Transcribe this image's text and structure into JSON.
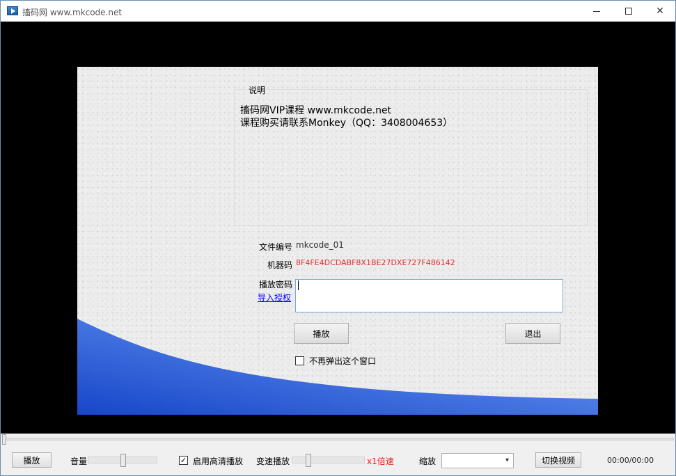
{
  "window": {
    "title": "搐码网 www.mkcode.net",
    "minimize_glyph": "",
    "close_glyph": "✕"
  },
  "dialog": {
    "group_title": "说明",
    "desc_line1": "搐码网VIP课程 www.mkcode.net",
    "desc_line2": "课程购买请联系Monkey（QQ：3408004653）",
    "file_label": "文件编号",
    "file_value": "mkcode_01",
    "machine_label": "机器码",
    "machine_value": "8F4FE4DCDABF8X1BE27DXE727F486142",
    "password_label": "播放密码",
    "password_value": "",
    "import_link": "导入授权",
    "play_button": "播放",
    "exit_button": "退出",
    "no_popup_label": "不再弹出这个窗口",
    "no_popup_checked": false
  },
  "controls": {
    "play_button": "播放",
    "volume_label": "音量",
    "volume_level": 0.5,
    "hd_label": "启用高清播放",
    "hd_checked": true,
    "hd_check_glyph": "✓",
    "speed_label": "变速播放",
    "speed_level": 0.2,
    "speed_value": "x1倍速",
    "zoom_label": "缩放",
    "zoom_value": "",
    "zoom_arrow": "▾",
    "switch_button": "切换视频",
    "time": "00:00/00:00",
    "progress": 0
  },
  "colors": {
    "accent_link": "#0000ee",
    "machine_code": "#e03030",
    "speed_text": "#e02020",
    "wave_blue": "#1a4fd0"
  }
}
